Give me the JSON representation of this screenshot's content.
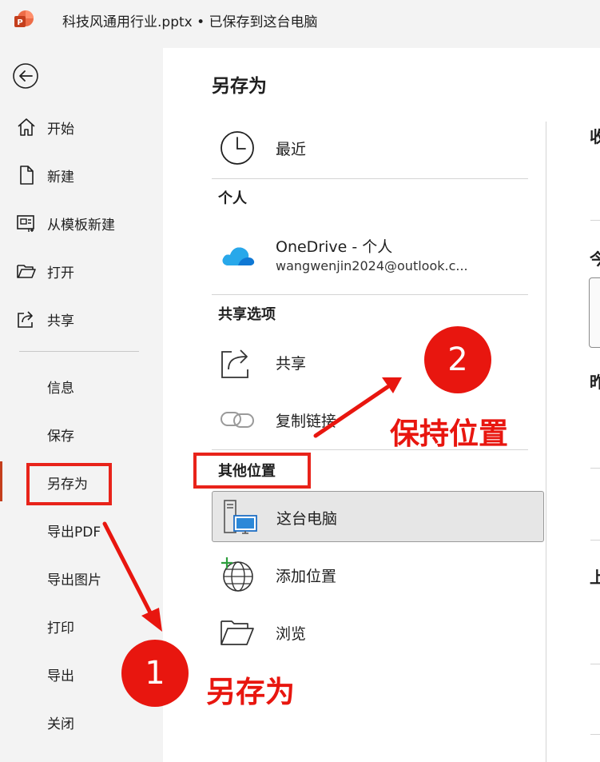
{
  "window": {
    "title": "科技风通用行业.pptx • 已保存到这台电脑"
  },
  "sidebar": {
    "nav_main": [
      {
        "label": "开始",
        "icon": "home-icon"
      },
      {
        "label": "新建",
        "icon": "new-file-icon"
      },
      {
        "label": "从模板新建",
        "icon": "template-icon"
      },
      {
        "label": "打开",
        "icon": "folder-open-icon"
      },
      {
        "label": "共享",
        "icon": "share-icon"
      }
    ],
    "nav_sub": [
      {
        "label": "信息"
      },
      {
        "label": "保存"
      },
      {
        "label": "另存为",
        "active": true
      },
      {
        "label": "导出PDF"
      },
      {
        "label": "导出图片"
      },
      {
        "label": "打印"
      },
      {
        "label": "导出"
      },
      {
        "label": "关闭"
      }
    ]
  },
  "main": {
    "title": "另存为",
    "recent": {
      "label": "最近"
    },
    "sections": {
      "personal": "个人",
      "share_options": "共享选项",
      "other_locations": "其他位置"
    },
    "onedrive": {
      "label": "OneDrive - 个人",
      "account": "wangwenjin2024@outlook.c..."
    },
    "share": {
      "label": "共享"
    },
    "copy_link": {
      "label": "复制链接"
    },
    "this_pc": {
      "label": "这台电脑"
    },
    "add_location": {
      "label": "添加位置"
    },
    "browse": {
      "label": "浏览"
    }
  },
  "right_panel": {
    "fragments": [
      "收",
      "今",
      "昨",
      "上"
    ]
  },
  "annotations": {
    "badge1": "1",
    "badge2": "2",
    "label1": "另存为",
    "label2": "保持位置",
    "color": "#e8160f"
  },
  "colors": {
    "accent": "#c43e1c",
    "annotation": "#e8160f",
    "selected_bg": "#e6e6e6"
  }
}
